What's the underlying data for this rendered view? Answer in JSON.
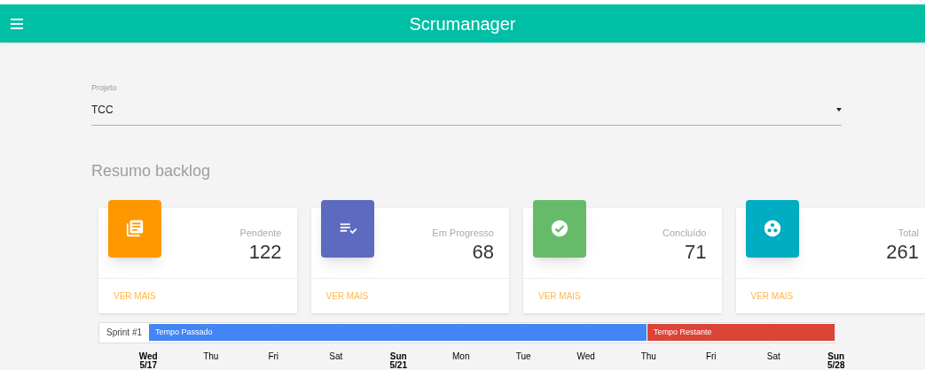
{
  "app_bar": {
    "title": "Scrumanager"
  },
  "project_field": {
    "label": "Projeto",
    "value": "TCC"
  },
  "section_title": "Resumo backlog",
  "cards": [
    {
      "kind": "pending",
      "color": "#ff9800",
      "label": "Pendente",
      "count": "122",
      "link": "VER MAIS"
    },
    {
      "kind": "progress",
      "color": "#5c6bc0",
      "label": "Em Progresso",
      "count": "68",
      "link": "VER MAIS"
    },
    {
      "kind": "done",
      "color": "#66bb6a",
      "label": "Concluído",
      "count": "71",
      "link": "VER MAIS"
    },
    {
      "kind": "total",
      "color": "#00acc1",
      "label": "Total",
      "count": "261",
      "link": "VER MAIS"
    }
  ],
  "timeline": {
    "row_label": "Sprint #1",
    "elapsed": {
      "label": "Tempo Passado",
      "color": "#4285f4",
      "level": 0.727
    },
    "remaining": {
      "label": "Tempo Restante",
      "color": "#db4437"
    },
    "days": [
      {
        "kind": "major",
        "day": "Wed",
        "date": "5/17"
      },
      {
        "kind": "minor",
        "day": "Thu"
      },
      {
        "kind": "minor",
        "day": "Fri"
      },
      {
        "kind": "minor",
        "day": "Sat"
      },
      {
        "kind": "major",
        "day": "Sun",
        "date": "5/21"
      },
      {
        "kind": "minor",
        "day": "Mon"
      },
      {
        "kind": "minor",
        "day": "Tue"
      },
      {
        "kind": "minor",
        "day": "Wed"
      },
      {
        "kind": "minor",
        "day": "Thu"
      },
      {
        "kind": "minor",
        "day": "Fri"
      },
      {
        "kind": "minor",
        "day": "Sat"
      },
      {
        "kind": "major",
        "day": "Sun",
        "date": "5/28"
      }
    ]
  }
}
